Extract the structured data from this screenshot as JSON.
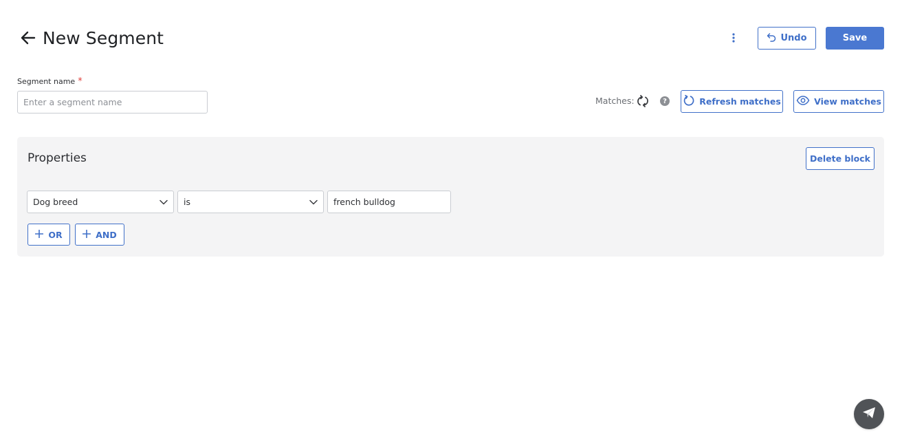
{
  "header": {
    "title": "New Segment",
    "undo_label": "Undo",
    "save_label": "Save"
  },
  "segment": {
    "name_label": "Segment name",
    "required_mark": "*",
    "name_placeholder": "Enter a segment name",
    "name_value": ""
  },
  "matches": {
    "label": "Matches:",
    "help_glyph": "?",
    "refresh_label": "Refresh matches",
    "view_label": "View matches"
  },
  "block": {
    "title": "Properties",
    "delete_label": "Delete block",
    "condition": {
      "property": "Dog breed",
      "operator": "is",
      "value": "french bulldog"
    },
    "or_label": "OR",
    "and_label": "AND"
  },
  "colors": {
    "accent": "#3f6fc8",
    "primary_button": "#4a78d1",
    "block_background": "#f4f4f5",
    "required": "#e0413b",
    "chat_fab": "#505357"
  },
  "icons": {
    "back": "arrow-left-icon",
    "more": "kebab-vertical-icon",
    "undo": "undo-icon",
    "sync": "sync-icon",
    "help": "help-circle-icon",
    "refresh": "refresh-icon",
    "view": "eye-icon",
    "dropdown": "chevron-down-icon",
    "add": "plus-icon",
    "chat": "paper-plane-icon"
  }
}
